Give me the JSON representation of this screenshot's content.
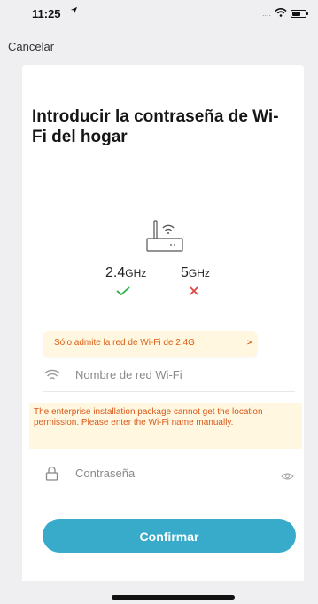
{
  "status_bar": {
    "time": "11:25",
    "location_icon": "location-arrow-icon",
    "signal_dots": "....",
    "wifi_icon": "wifi-icon",
    "battery_icon": "battery-icon"
  },
  "nav": {
    "cancel_label": "Cancelar"
  },
  "card": {
    "title": "Introducir la contraseña de Wi-Fi del hogar",
    "router_icon": "router-icon",
    "bands": [
      {
        "label": "2.4",
        "unit": "GHz",
        "supported": true,
        "mark_icon": "check-icon",
        "mark_color": "#2bb34a"
      },
      {
        "label": "5",
        "unit": "GHz",
        "supported": false,
        "mark_icon": "cross-icon",
        "mark_color": "#e04545"
      }
    ],
    "tooltip": {
      "text": "Sólo admite la red de Wi-Fi de 2,4G",
      "chevron": ">"
    },
    "wifi_field": {
      "icon": "wifi-icon",
      "placeholder": "Nombre de red Wi-Fi",
      "value": ""
    },
    "warning_text": "The enterprise installation package cannot get the location permission. Please enter the Wi-Fi name manually.",
    "password_field": {
      "icon": "lock-icon",
      "placeholder": "Contraseña",
      "value": "",
      "toggle_icon": "eye-icon"
    },
    "confirm_label": "Confirmar"
  },
  "colors": {
    "accent": "#39abca",
    "warning_bg": "#fff7df",
    "warning_text": "#d9591a",
    "background": "#efeff1"
  }
}
